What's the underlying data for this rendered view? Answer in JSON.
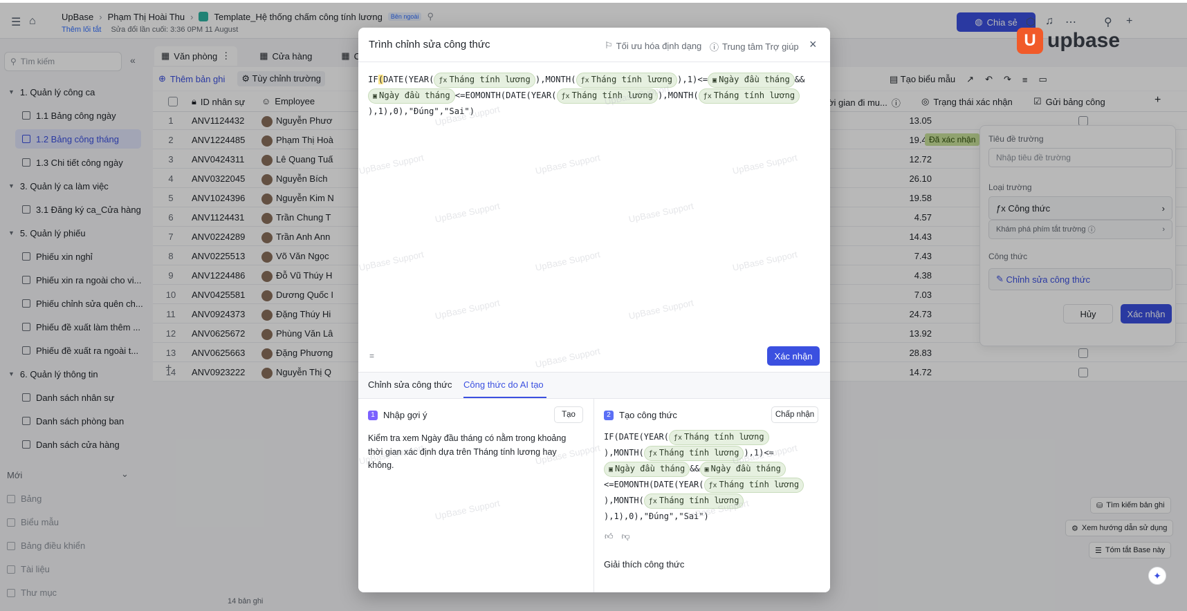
{
  "topbar": {
    "breadcrumb": [
      "UpBase",
      "Phạm Thị Hoài Thu",
      "Template_Hệ thống chấm công tính lương"
    ],
    "external_badge": "Bên ngoài",
    "add_tag_link": "Thêm lối tắt",
    "last_edit": "Sửa đổi lần cuối: 3:36 0PM 11 August",
    "share_label": "Chia sẻ",
    "logo_text": "upbase",
    "logo_mark": "U"
  },
  "sidebar": {
    "search_placeholder": "Tìm kiếm",
    "items": [
      {
        "type": "group",
        "label": "1. Quản lý công ca"
      },
      {
        "type": "sub",
        "label": "1.1 Bảng công ngày"
      },
      {
        "type": "sub",
        "label": "1.2 Bảng công tháng",
        "active": true
      },
      {
        "type": "sub",
        "label": "1.3 Chi tiết công ngày"
      },
      {
        "type": "group",
        "label": "3. Quản lý ca làm việc"
      },
      {
        "type": "sub",
        "label": "3.1 Đăng ký ca_Cửa hàng"
      },
      {
        "type": "group",
        "label": "5. Quản lý phiếu"
      },
      {
        "type": "sub",
        "label": "Phiếu xin nghỉ"
      },
      {
        "type": "sub",
        "label": "Phiếu xin ra ngoài cho vi..."
      },
      {
        "type": "sub",
        "label": "Phiếu chỉnh sửa quên ch..."
      },
      {
        "type": "sub",
        "label": "Phiếu đề xuất làm thêm ..."
      },
      {
        "type": "sub",
        "label": "Phiếu đề xuất ra ngoài t..."
      },
      {
        "type": "group",
        "label": "6. Quản lý thông tin"
      },
      {
        "type": "sub",
        "label": "Danh sách nhân sự"
      },
      {
        "type": "sub",
        "label": "Danh sách phòng ban"
      },
      {
        "type": "sub",
        "label": "Danh sách cửa hàng"
      }
    ],
    "new_label": "Mới",
    "new_items": [
      "Bảng",
      "Biểu mẫu",
      "Bảng điều khiển",
      "Tài liệu",
      "Thư mục"
    ]
  },
  "main": {
    "tabs": [
      "Văn phòng",
      "Cửa hàng",
      "CS"
    ],
    "add_record": "Thêm bản ghi",
    "customize_fields": "Tùy chỉnh trường",
    "create_form": "Tạo biểu mẫu",
    "columns": [
      "ID nhân sự",
      "Employee",
      "ời gian đi mu...",
      "Trạng thái xác nhận",
      "Gửi bảng công"
    ],
    "rows": [
      {
        "n": "1",
        "id": "ANV1124432",
        "name": "Nguyễn Phươ",
        "val": "13.05",
        "status": ""
      },
      {
        "n": "2",
        "id": "ANV1224485",
        "name": "Phạm Thị Hoà",
        "val": "19.47",
        "status": "Đã xác nhận"
      },
      {
        "n": "3",
        "id": "ANV0424311",
        "name": "Lê Quang Tuấ",
        "val": "12.72",
        "status": ""
      },
      {
        "n": "4",
        "id": "ANV0322045",
        "name": "Nguyễn Bích",
        "val": "26.10",
        "status": ""
      },
      {
        "n": "5",
        "id": "ANV1024396",
        "name": "Nguyễn Kim N",
        "val": "19.58",
        "status": ""
      },
      {
        "n": "6",
        "id": "ANV1124431",
        "name": "Trần Chung T",
        "val": "4.57",
        "status": ""
      },
      {
        "n": "7",
        "id": "ANV0224289",
        "name": "Trần Anh Ann",
        "val": "14.43",
        "status": ""
      },
      {
        "n": "8",
        "id": "ANV0225513",
        "name": "Võ Văn Ngọc",
        "val": "7.43",
        "status": ""
      },
      {
        "n": "9",
        "id": "ANV1224486",
        "name": "Đỗ Vũ Thúy H",
        "val": "4.38",
        "status": ""
      },
      {
        "n": "10",
        "id": "ANV0425581",
        "name": "Dương Quốc I",
        "val": "7.03",
        "status": ""
      },
      {
        "n": "11",
        "id": "ANV0924373",
        "name": "Đặng Thúy Hi",
        "val": "24.73",
        "status": ""
      },
      {
        "n": "12",
        "id": "ANV0625672",
        "name": "Phùng Văn Lâ",
        "val": "13.92",
        "status": ""
      },
      {
        "n": "13",
        "id": "ANV0625663",
        "name": "Đặng Phương",
        "val": "28.83",
        "status": ""
      },
      {
        "n": "14",
        "id": "ANV0923222",
        "name": "Nguyễn Thị Q",
        "val": "14.72",
        "status": ""
      }
    ],
    "record_count": "14 bản ghi"
  },
  "field_panel": {
    "title_label": "Tiêu đề trường",
    "title_placeholder": "Nhập tiêu đề trường",
    "type_label": "Loại trường",
    "type_value": "Công thức",
    "shortcut_hint": "Khám phá phím tắt trường",
    "formula_label": "Công thức",
    "edit_formula": "Chỉnh sửa công thức",
    "cancel": "Hủy",
    "confirm": "Xác nhận"
  },
  "floating_buttons": [
    "Tìm kiếm bản ghi",
    "Xem hướng dẫn sử dụng",
    "Tóm tắt Base này"
  ],
  "modal": {
    "title": "Trình chỉnh sửa công thức",
    "optimize": "Tối ưu hóa định dạng",
    "help": "Trung tâm Trợ giúp",
    "formula": {
      "t1": "IF",
      "t1b": "(",
      "t2": "DATE(YEAR(",
      "f_month": "Tháng tính lương",
      "t3": "),MONTH(",
      "t4": "),1)<=",
      "f_day": "Ngày đầu tháng",
      "t5": "&&",
      "t6": "<=EOMONTH(DATE(YEAR(",
      "t7": "),MONTH(",
      "t8": "),1),0),\"Đúng\",\"Sai\")"
    },
    "eq_sign": "=",
    "confirm": "Xác nhận",
    "tab_edit": "Chỉnh sửa công thức",
    "tab_ai": "Công thức do AI tạo",
    "step1_num": "1",
    "step1_label": "Nhập gợi ý",
    "step1_btn": "Tạo",
    "prompt": "Kiểm tra xem Ngày đầu tháng có nằm trong khoảng thời gian xác định dựa trên Tháng tính lương hay không.",
    "step2_num": "2",
    "step2_label": "Tạo công thức",
    "step2_btn": "Chấp nhận",
    "ai": {
      "l1": "IF(DATE(YEAR(",
      "l2": "),MONTH(",
      "l2b": "),1)<=",
      "l3b": "&&",
      "l4": "<=EOMONTH(DATE(YEAR(",
      "l5": "),MONTH(",
      "l6": "),1),0),\"Đúng\",\"Sai\")"
    },
    "explain": "Giải thích công thức"
  },
  "watermark": "UpBase Support"
}
